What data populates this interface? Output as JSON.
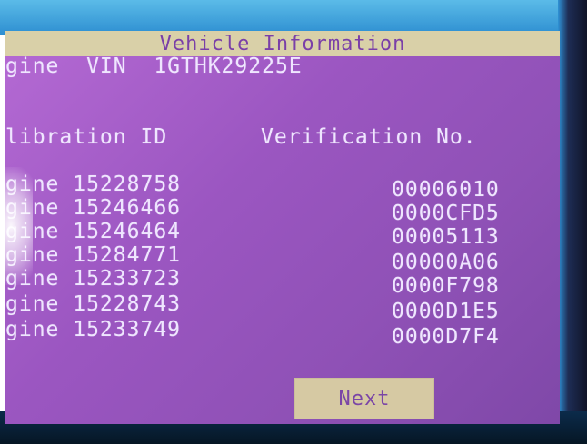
{
  "screen": {
    "title": "Vehicle Information",
    "vin_row": "gine  VIN  1GTHK29225E",
    "calibration_header": "libration ID",
    "verification_header": "Verification No.",
    "rows": [
      {
        "left": "gine 15228758",
        "right": "00006010"
      },
      {
        "left": "gine 15246466",
        "right": "0000CFD5"
      },
      {
        "left": "gine 15246464",
        "right": "00005113"
      },
      {
        "left": "gine 15284771",
        "right": "00000A06"
      },
      {
        "left": "gine 15233723",
        "right": "0000F798"
      },
      {
        "left": "gine 15228743",
        "right": "0000D1E5"
      },
      {
        "left": "gine 15233749",
        "right": "0000D7F4"
      }
    ],
    "next_label": "Next"
  },
  "colors": {
    "screen_purple": "#9b56c1",
    "title_bar": "#d9d0a8",
    "button": "#d6c9a3",
    "text": "#efe6ff",
    "bezel_blue": "#2e8fd1"
  }
}
